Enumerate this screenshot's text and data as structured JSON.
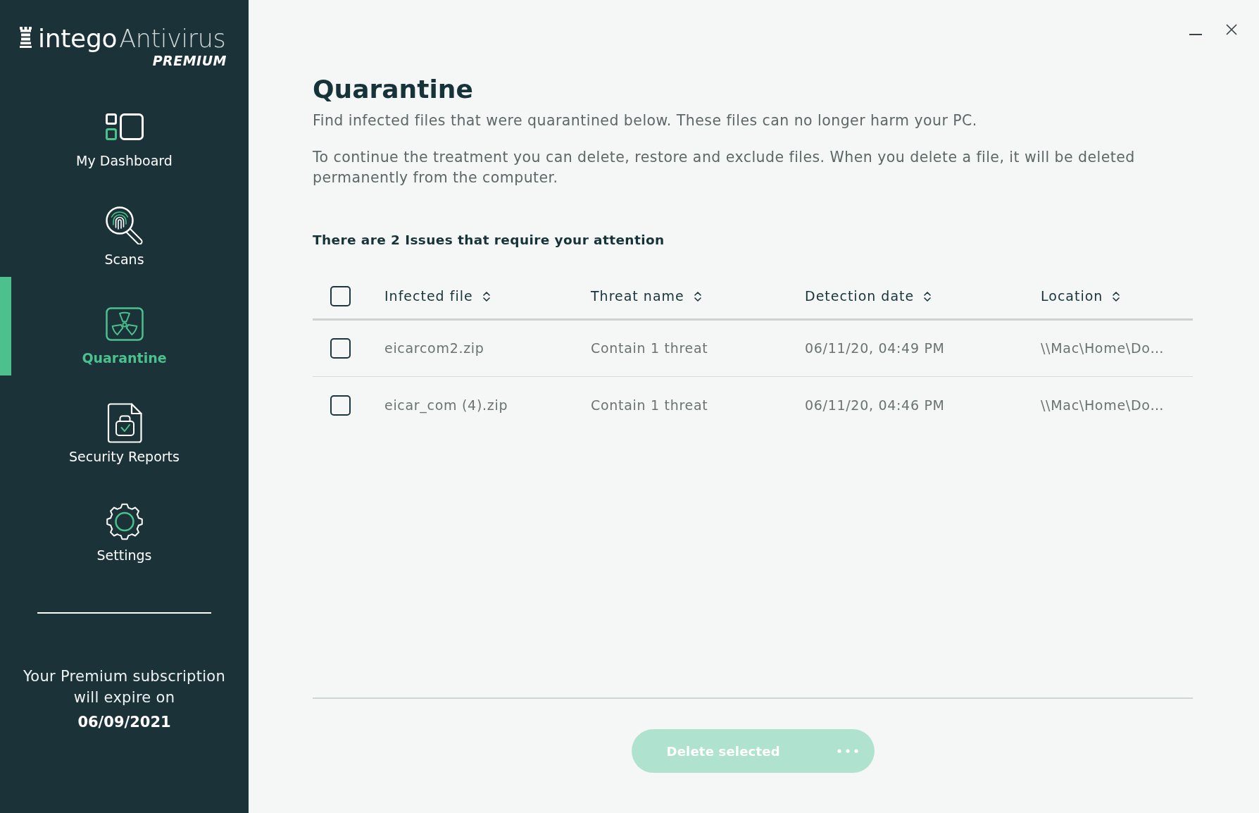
{
  "logo": {
    "brand": "intego",
    "product": "Antivirus",
    "edition": "PREMIUM"
  },
  "sidebar": {
    "items": [
      {
        "kind": "dashboard",
        "label": "My Dashboard",
        "selected": false
      },
      {
        "kind": "scans",
        "label": "Scans",
        "selected": false
      },
      {
        "kind": "quarantine",
        "label": "Quarantine",
        "selected": true
      },
      {
        "kind": "reports",
        "label": "Security Reports",
        "selected": false
      },
      {
        "kind": "settings",
        "label": "Settings",
        "selected": false
      }
    ],
    "subscription": {
      "message": "Your Premium subscription will expire on",
      "date": "06/09/2021"
    }
  },
  "page": {
    "title": "Quarantine",
    "intro": "Find infected files that were quarantined below. These files can no longer harm your PC.",
    "details": "To continue the treatment you can delete, restore and exclude files. When you delete a file, it will be deleted permanently from the computer.",
    "issues_heading": "There are 2 Issues that require your attention"
  },
  "table": {
    "select_all": {
      "checked": false
    },
    "columns": [
      {
        "label": "Infected file",
        "sortable": true
      },
      {
        "label": "Threat name",
        "sortable": true
      },
      {
        "label": "Detection date",
        "sortable": true
      },
      {
        "label": "Location",
        "sortable": true
      }
    ],
    "rows": [
      {
        "checked": false,
        "cells": [
          "eicarcom2.zip",
          "Contain 1 threat",
          "06/11/20, 04:49 PM",
          "\\\\Mac\\Home\\Do…"
        ]
      },
      {
        "checked": false,
        "cells": [
          "eicar_com (4).zip",
          "Contain 1 threat",
          "06/11/20, 04:46 PM",
          "\\\\Mac\\Home\\Do…"
        ]
      }
    ]
  },
  "actions": {
    "delete": {
      "label": "Delete selected",
      "disabled": true
    }
  }
}
